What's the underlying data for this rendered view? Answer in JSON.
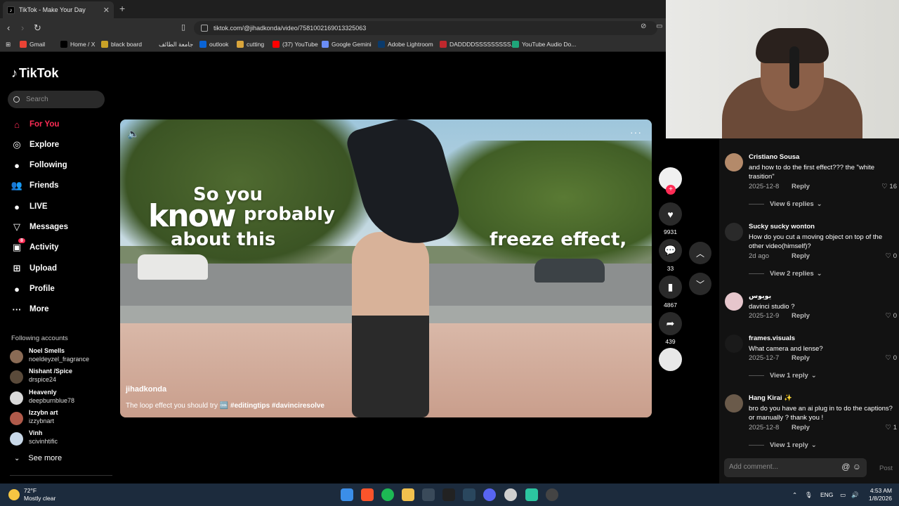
{
  "browser": {
    "tab_title": "TikTok - Make Your Day",
    "tab_close": "✕",
    "new_tab": "+",
    "url": "tiktok.com/@jihadkonda/video/7581002169013325063",
    "bookmarks": [
      {
        "label": "Gmail",
        "color": "#ea4335"
      },
      {
        "label": "Home / X",
        "color": "#000000"
      },
      {
        "label": "black board",
        "color": "#c9a227"
      },
      {
        "label": "جامعة الطائف",
        "color": "#2f2f2f"
      },
      {
        "label": "outlook",
        "color": "#0a64d6"
      },
      {
        "label": "cutting",
        "color": "#d9a53b"
      },
      {
        "label": "(37) YouTube",
        "color": "#ff0000"
      },
      {
        "label": "Google Gemini",
        "color": "#6b8df5"
      },
      {
        "label": "Adobe Lightroom",
        "color": "#0a3a6b"
      },
      {
        "label": "DADDDDSSSSSSSSS...",
        "color": "#c0282d"
      },
      {
        "label": "YouTube Audio Do...",
        "color": "#1fa67a"
      }
    ]
  },
  "sidebar": {
    "logo": "TikTok",
    "search_placeholder": "Search",
    "nav": [
      {
        "label": "For You",
        "icon": "home-icon",
        "glyph": "⌂"
      },
      {
        "label": "Explore",
        "icon": "compass-icon",
        "glyph": "◎"
      },
      {
        "label": "Following",
        "icon": "following-icon",
        "glyph": "●"
      },
      {
        "label": "Friends",
        "icon": "friends-icon",
        "glyph": "👥"
      },
      {
        "label": "LIVE",
        "icon": "live-icon",
        "glyph": "●"
      },
      {
        "label": "Messages",
        "icon": "messages-icon",
        "glyph": "▽"
      },
      {
        "label": "Activity",
        "icon": "activity-icon",
        "glyph": "▣"
      },
      {
        "label": "Upload",
        "icon": "upload-icon",
        "glyph": "⊞"
      },
      {
        "label": "Profile",
        "icon": "profile-icon",
        "glyph": "●"
      },
      {
        "label": "More",
        "icon": "more-icon",
        "glyph": "···"
      }
    ],
    "activity_badge": "8",
    "following_title": "Following accounts",
    "accounts": [
      {
        "name": "Noel Smells",
        "handle": "noeldeyzel_fragrance",
        "color": "#8a6b55"
      },
      {
        "name": "Nishant /Spice",
        "handle": "drspice24",
        "color": "#5a4a3a"
      },
      {
        "name": "Heavenly",
        "handle": "deepburnblue78",
        "color": "#d9d9d9"
      },
      {
        "name": "Izzybn art",
        "handle": "izzybnart",
        "color": "#b05a4a"
      },
      {
        "name": "Vinh",
        "handle": "scivinhtific",
        "color": "#c8d8e8"
      }
    ],
    "see_more": "See more"
  },
  "video": {
    "text_so_you": "So you",
    "text_know": "know",
    "text_probably": "probably",
    "text_about_this": "about this",
    "text_freeze": "freeze  effect,",
    "author": "jihadkonda",
    "caption": "The loop effect you should try",
    "caption_emoji": "🆒",
    "hashtags": "#editingtips #davinciresolve",
    "more": "···"
  },
  "actions": {
    "likes": "9931",
    "comments": "33",
    "saves": "4867",
    "shares": "439"
  },
  "comments": [
    {
      "name": "Cristiano Sousa",
      "text": "and how to do the first effect??? the \"white trasition\"",
      "date": "2025-12-8",
      "reply": "Reply",
      "likes": "16",
      "color": "#b48a6a",
      "view": "View 6 replies"
    },
    {
      "name": "Sucky sucky wonton",
      "text": "How do you cut a moving object on top of the other video(himself)?",
      "date": "2d ago",
      "reply": "Reply",
      "likes": "0",
      "color": "#2a2a2a",
      "view": "View 2 replies"
    },
    {
      "name": "يويوس",
      "text": "davinci studio ?",
      "date": "2025-12-9",
      "reply": "Reply",
      "likes": "0",
      "color": "#e6c6cc",
      "view": ""
    },
    {
      "name": "frames.visuals",
      "text": "What camera and lense?",
      "date": "2025-12-7",
      "reply": "Reply",
      "likes": "0",
      "color": "#1a1a1a",
      "view": "View 1 reply"
    },
    {
      "name": "Hang Kirai ✨",
      "text": "bro do you have an ai plug in to do the captions? or manually ? thank you !",
      "date": "2025-12-8",
      "reply": "Reply",
      "likes": "1",
      "color": "#6a5a4a",
      "view": "View 1 reply"
    }
  ],
  "comment_box": {
    "placeholder": "Add comment...",
    "post": "Post"
  },
  "taskbar": {
    "temp": "72°F",
    "weather": "Mostly clear",
    "lang": "ENG",
    "time": "4:53 AM",
    "date": "1/8/2026"
  }
}
